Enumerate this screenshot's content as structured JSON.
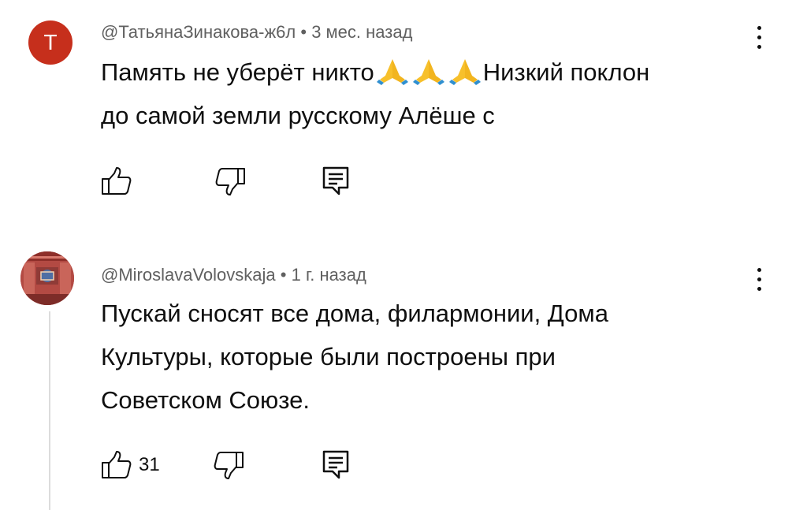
{
  "comments": [
    {
      "avatar_letter": "T",
      "author": "@ТатьянаЗинакова-ж6л",
      "time": "3 мес. назад",
      "text_lines": [
        "Память не уберёт никто",
        "Низкий поклон",
        "до самой земли русскому Алёше с"
      ],
      "emoji": [
        "folded-hands",
        "folded-hands",
        "folded-hands"
      ],
      "like_count": ""
    },
    {
      "avatar_image": "avatar-photo",
      "author": "@MiroslavaVolovskaja",
      "time": "1 г. назад",
      "text_lines": [
        "Пускай сносят все дома, филармонии, Дома",
        "Культуры, которые были построены при",
        "Советском Союзе."
      ],
      "like_count": "31"
    }
  ],
  "colors": {
    "avatar_red": "#c62f1c",
    "meta_gray": "#606060",
    "text": "#0f0f0f"
  },
  "icons": [
    "thumb-up-icon",
    "thumb-down-icon",
    "reply-icon",
    "more-vert-icon"
  ]
}
